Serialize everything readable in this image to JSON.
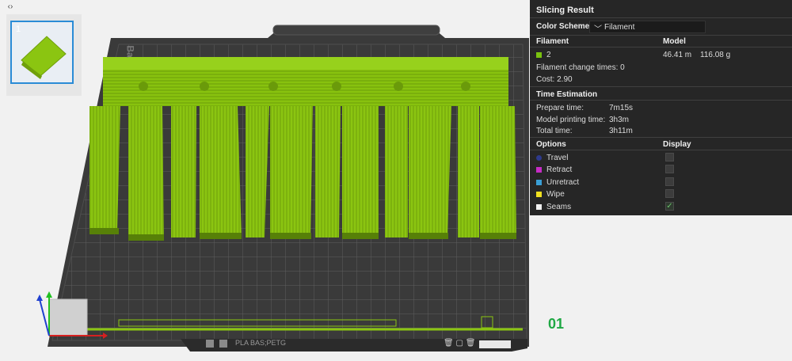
{
  "panel": {
    "title": "Slicing Result",
    "color_scheme_label": "Color Scheme",
    "color_scheme_value": "Filament",
    "filament_header": "Filament",
    "model_header": "Model",
    "filament_id": "2",
    "filament_color": "#7ac20f",
    "length": "46.41 m",
    "weight": "116.08 g",
    "change_times": "Filament change times:  0",
    "cost": "Cost:  2.90",
    "time_header": "Time Estimation",
    "prepare_label": "Prepare time:",
    "prepare_value": "7m15s",
    "printing_label": "Model printing time:",
    "printing_value": "3h3m",
    "total_label": "Total time:",
    "total_value": "3h11m",
    "options_header": "Options",
    "display_header": "Display",
    "options": [
      {
        "label": "Travel",
        "color": "#2e3a8c",
        "checked": false
      },
      {
        "label": "Retract",
        "color": "#c62cc6",
        "checked": false
      },
      {
        "label": "Unretract",
        "color": "#3a9fd6",
        "checked": false
      },
      {
        "label": "Wipe",
        "color": "#f0e020",
        "checked": false
      },
      {
        "label": "Seams",
        "color": "#f0f0f0",
        "checked": true
      }
    ]
  },
  "plate": {
    "thumb_index": "1",
    "plate_number": "01",
    "bed_label": "PLA BAS;PETG",
    "brand_mark": "Ba"
  }
}
